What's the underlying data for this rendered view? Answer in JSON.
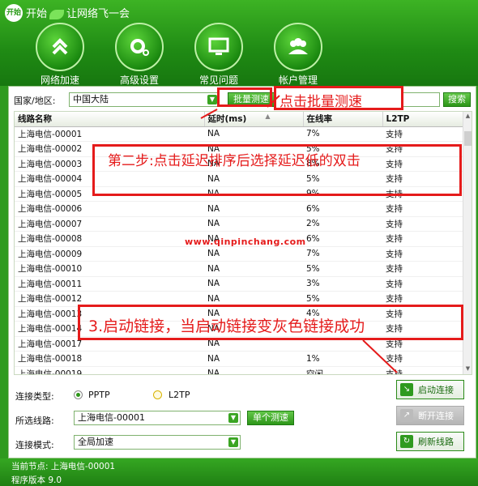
{
  "app": {
    "title": "开始",
    "slogan": "让网络飞一会",
    "logo_text": "开始"
  },
  "nav": [
    {
      "label": "网络加速",
      "icon": "chevron-up-double-icon"
    },
    {
      "label": "高级设置",
      "icon": "gear-icon"
    },
    {
      "label": "常见问题",
      "icon": "monitor-icon"
    },
    {
      "label": "帐户管理",
      "icon": "users-icon"
    }
  ],
  "search": {
    "country_label": "国家/地区:",
    "country_value": "中国大陆",
    "batch_test_label": "批量测速",
    "search_value": "",
    "search_button": "搜索"
  },
  "table": {
    "headers": {
      "name": "线路名称",
      "latency": "延时(ms)",
      "online": "在线率",
      "l2tp": "L2TP"
    },
    "rows": [
      {
        "name": "上海电信-00001",
        "latency": "NA",
        "online": "7%",
        "l2tp": "支持"
      },
      {
        "name": "上海电信-00002",
        "latency": "NA",
        "online": "5%",
        "l2tp": "支持"
      },
      {
        "name": "上海电信-00003",
        "latency": "NA",
        "online": "8%",
        "l2tp": "支持"
      },
      {
        "name": "上海电信-00004",
        "latency": "NA",
        "online": "5%",
        "l2tp": "支持"
      },
      {
        "name": "上海电信-00005",
        "latency": "NA",
        "online": "9%",
        "l2tp": "支持"
      },
      {
        "name": "上海电信-00006",
        "latency": "NA",
        "online": "6%",
        "l2tp": "支持"
      },
      {
        "name": "上海电信-00007",
        "latency": "NA",
        "online": "2%",
        "l2tp": "支持"
      },
      {
        "name": "上海电信-00008",
        "latency": "NA",
        "online": "6%",
        "l2tp": "支持"
      },
      {
        "name": "上海电信-00009",
        "latency": "NA",
        "online": "7%",
        "l2tp": "支持"
      },
      {
        "name": "上海电信-00010",
        "latency": "NA",
        "online": "5%",
        "l2tp": "支持"
      },
      {
        "name": "上海电信-00011",
        "latency": "NA",
        "online": "3%",
        "l2tp": "支持"
      },
      {
        "name": "上海电信-00012",
        "latency": "NA",
        "online": "5%",
        "l2tp": "支持"
      },
      {
        "name": "上海电信-00013",
        "latency": "NA",
        "online": "4%",
        "l2tp": "支持"
      },
      {
        "name": "上海电信-00014",
        "latency": "NA",
        "online": "",
        "l2tp": "支持"
      },
      {
        "name": "上海电信-00017",
        "latency": "NA",
        "online": "",
        "l2tp": "支持"
      },
      {
        "name": "上海电信-00018",
        "latency": "NA",
        "online": "1%",
        "l2tp": "支持"
      },
      {
        "name": "上海电信-00019",
        "latency": "NA",
        "online": "空闲",
        "l2tp": "支持"
      }
    ]
  },
  "form": {
    "conn_type_label": "连接类型:",
    "pptp": "PPTP",
    "l2tp": "L2TP",
    "line_label": "所选线路:",
    "line_value": "上海电信-00001",
    "single_test": "单个测速",
    "mode_label": "连接模式:",
    "mode_value": "全局加速"
  },
  "buttons": {
    "start": "启动连接",
    "disconnect": "断开连接",
    "refresh": "刷新线路"
  },
  "status": {
    "current_node": "当前节点: 上海电信-00001",
    "version": "程序版本 9.0"
  },
  "annotations": {
    "batch": "点击批量测速",
    "step2": "第二步:点击延迟排序后选择延迟低的双击",
    "step3": "3.启动链接，当启动链接变灰色链接成功",
    "watermark": "www.qinpinchang.com"
  },
  "colors": {
    "brand_green": "#2f9a1f",
    "annotation_red": "#e51b1b"
  }
}
